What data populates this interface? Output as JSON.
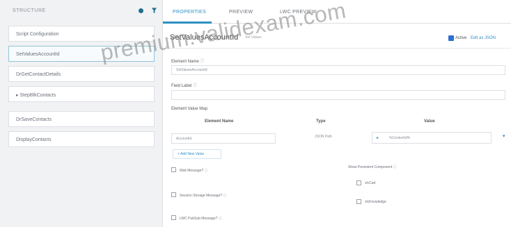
{
  "structure": {
    "header": "STRUCTURE",
    "items": [
      {
        "label": "Script Configuration"
      },
      {
        "label": "SetValuesAccountId"
      },
      {
        "label": "DrGetContactDetails"
      },
      {
        "label": "▸  StepBlkContacts"
      },
      {
        "label": "DrSaveContacts"
      },
      {
        "label": "DisplayContacts"
      }
    ]
  },
  "tabs": [
    {
      "label": "PROPERTIES"
    },
    {
      "label": "PREVIEW"
    },
    {
      "label": "LWC PREVIEW"
    }
  ],
  "properties": {
    "title": "SetValuesAccountId",
    "subtitle": "Set Values",
    "active_label": "Active",
    "json_link": "Edit as JSON",
    "element_name_label": "Element Name",
    "element_name_value": "SetValuesAccountId",
    "field_label_label": "Field Label",
    "element_value_map_label": "Element Value Map",
    "columns": {
      "element_name": "Element Name",
      "type": "Type",
      "value": "Value"
    },
    "row": {
      "element_name": "AccountId",
      "type": "JSON Path",
      "value": "%ContextId%"
    },
    "add_button": "+ Add New Value",
    "show_persistent_label": "Show Persistent Component",
    "checkboxes": {
      "wait_message": "Wait Message?",
      "session_storage": "Session Storage Message?",
      "lwc_pubsub": "LWC PubSub Message?",
      "cart": "vlcCart",
      "knowledge": "vlcKnowledge"
    }
  },
  "watermark": "premium.validexam.com",
  "colors": {
    "accent": "#2e8fc2",
    "active_checkbox": "#2e6fd2"
  }
}
